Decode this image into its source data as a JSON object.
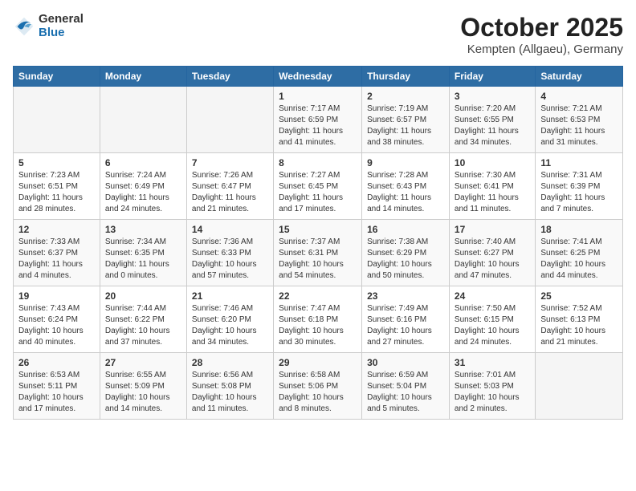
{
  "logo": {
    "general": "General",
    "blue": "Blue"
  },
  "header": {
    "month": "October 2025",
    "location": "Kempten (Allgaeu), Germany"
  },
  "weekdays": [
    "Sunday",
    "Monday",
    "Tuesday",
    "Wednesday",
    "Thursday",
    "Friday",
    "Saturday"
  ],
  "weeks": [
    [
      {
        "day": "",
        "sunrise": "",
        "sunset": "",
        "daylight": ""
      },
      {
        "day": "",
        "sunrise": "",
        "sunset": "",
        "daylight": ""
      },
      {
        "day": "",
        "sunrise": "",
        "sunset": "",
        "daylight": ""
      },
      {
        "day": "1",
        "sunrise": "Sunrise: 7:17 AM",
        "sunset": "Sunset: 6:59 PM",
        "daylight": "Daylight: 11 hours and 41 minutes."
      },
      {
        "day": "2",
        "sunrise": "Sunrise: 7:19 AM",
        "sunset": "Sunset: 6:57 PM",
        "daylight": "Daylight: 11 hours and 38 minutes."
      },
      {
        "day": "3",
        "sunrise": "Sunrise: 7:20 AM",
        "sunset": "Sunset: 6:55 PM",
        "daylight": "Daylight: 11 hours and 34 minutes."
      },
      {
        "day": "4",
        "sunrise": "Sunrise: 7:21 AM",
        "sunset": "Sunset: 6:53 PM",
        "daylight": "Daylight: 11 hours and 31 minutes."
      }
    ],
    [
      {
        "day": "5",
        "sunrise": "Sunrise: 7:23 AM",
        "sunset": "Sunset: 6:51 PM",
        "daylight": "Daylight: 11 hours and 28 minutes."
      },
      {
        "day": "6",
        "sunrise": "Sunrise: 7:24 AM",
        "sunset": "Sunset: 6:49 PM",
        "daylight": "Daylight: 11 hours and 24 minutes."
      },
      {
        "day": "7",
        "sunrise": "Sunrise: 7:26 AM",
        "sunset": "Sunset: 6:47 PM",
        "daylight": "Daylight: 11 hours and 21 minutes."
      },
      {
        "day": "8",
        "sunrise": "Sunrise: 7:27 AM",
        "sunset": "Sunset: 6:45 PM",
        "daylight": "Daylight: 11 hours and 17 minutes."
      },
      {
        "day": "9",
        "sunrise": "Sunrise: 7:28 AM",
        "sunset": "Sunset: 6:43 PM",
        "daylight": "Daylight: 11 hours and 14 minutes."
      },
      {
        "day": "10",
        "sunrise": "Sunrise: 7:30 AM",
        "sunset": "Sunset: 6:41 PM",
        "daylight": "Daylight: 11 hours and 11 minutes."
      },
      {
        "day": "11",
        "sunrise": "Sunrise: 7:31 AM",
        "sunset": "Sunset: 6:39 PM",
        "daylight": "Daylight: 11 hours and 7 minutes."
      }
    ],
    [
      {
        "day": "12",
        "sunrise": "Sunrise: 7:33 AM",
        "sunset": "Sunset: 6:37 PM",
        "daylight": "Daylight: 11 hours and 4 minutes."
      },
      {
        "day": "13",
        "sunrise": "Sunrise: 7:34 AM",
        "sunset": "Sunset: 6:35 PM",
        "daylight": "Daylight: 11 hours and 0 minutes."
      },
      {
        "day": "14",
        "sunrise": "Sunrise: 7:36 AM",
        "sunset": "Sunset: 6:33 PM",
        "daylight": "Daylight: 10 hours and 57 minutes."
      },
      {
        "day": "15",
        "sunrise": "Sunrise: 7:37 AM",
        "sunset": "Sunset: 6:31 PM",
        "daylight": "Daylight: 10 hours and 54 minutes."
      },
      {
        "day": "16",
        "sunrise": "Sunrise: 7:38 AM",
        "sunset": "Sunset: 6:29 PM",
        "daylight": "Daylight: 10 hours and 50 minutes."
      },
      {
        "day": "17",
        "sunrise": "Sunrise: 7:40 AM",
        "sunset": "Sunset: 6:27 PM",
        "daylight": "Daylight: 10 hours and 47 minutes."
      },
      {
        "day": "18",
        "sunrise": "Sunrise: 7:41 AM",
        "sunset": "Sunset: 6:25 PM",
        "daylight": "Daylight: 10 hours and 44 minutes."
      }
    ],
    [
      {
        "day": "19",
        "sunrise": "Sunrise: 7:43 AM",
        "sunset": "Sunset: 6:24 PM",
        "daylight": "Daylight: 10 hours and 40 minutes."
      },
      {
        "day": "20",
        "sunrise": "Sunrise: 7:44 AM",
        "sunset": "Sunset: 6:22 PM",
        "daylight": "Daylight: 10 hours and 37 minutes."
      },
      {
        "day": "21",
        "sunrise": "Sunrise: 7:46 AM",
        "sunset": "Sunset: 6:20 PM",
        "daylight": "Daylight: 10 hours and 34 minutes."
      },
      {
        "day": "22",
        "sunrise": "Sunrise: 7:47 AM",
        "sunset": "Sunset: 6:18 PM",
        "daylight": "Daylight: 10 hours and 30 minutes."
      },
      {
        "day": "23",
        "sunrise": "Sunrise: 7:49 AM",
        "sunset": "Sunset: 6:16 PM",
        "daylight": "Daylight: 10 hours and 27 minutes."
      },
      {
        "day": "24",
        "sunrise": "Sunrise: 7:50 AM",
        "sunset": "Sunset: 6:15 PM",
        "daylight": "Daylight: 10 hours and 24 minutes."
      },
      {
        "day": "25",
        "sunrise": "Sunrise: 7:52 AM",
        "sunset": "Sunset: 6:13 PM",
        "daylight": "Daylight: 10 hours and 21 minutes."
      }
    ],
    [
      {
        "day": "26",
        "sunrise": "Sunrise: 6:53 AM",
        "sunset": "Sunset: 5:11 PM",
        "daylight": "Daylight: 10 hours and 17 minutes."
      },
      {
        "day": "27",
        "sunrise": "Sunrise: 6:55 AM",
        "sunset": "Sunset: 5:09 PM",
        "daylight": "Daylight: 10 hours and 14 minutes."
      },
      {
        "day": "28",
        "sunrise": "Sunrise: 6:56 AM",
        "sunset": "Sunset: 5:08 PM",
        "daylight": "Daylight: 10 hours and 11 minutes."
      },
      {
        "day": "29",
        "sunrise": "Sunrise: 6:58 AM",
        "sunset": "Sunset: 5:06 PM",
        "daylight": "Daylight: 10 hours and 8 minutes."
      },
      {
        "day": "30",
        "sunrise": "Sunrise: 6:59 AM",
        "sunset": "Sunset: 5:04 PM",
        "daylight": "Daylight: 10 hours and 5 minutes."
      },
      {
        "day": "31",
        "sunrise": "Sunrise: 7:01 AM",
        "sunset": "Sunset: 5:03 PM",
        "daylight": "Daylight: 10 hours and 2 minutes."
      },
      {
        "day": "",
        "sunrise": "",
        "sunset": "",
        "daylight": ""
      }
    ]
  ]
}
